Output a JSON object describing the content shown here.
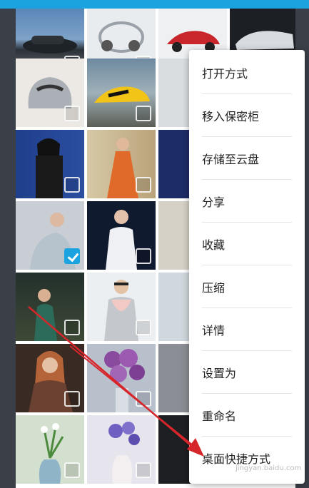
{
  "colors": {
    "accent": "#1aa3de",
    "annotation_arrow": "#d6262b"
  },
  "photo_grid": {
    "thumbnails": [
      {
        "subject": "dark-sedan-car",
        "checked": false
      },
      {
        "subject": "silver-concept-car",
        "checked": false
      },
      {
        "subject": "red-sports-car",
        "checked": false
      },
      {
        "subject": "white-concept-car",
        "checked": false
      },
      {
        "subject": "silver-supercar",
        "checked": false
      },
      {
        "subject": "yellow-race-car",
        "checked": false
      },
      {
        "subject": "car-partial",
        "checked": false
      },
      {
        "subject": "woman-dark-outfit",
        "checked": false
      },
      {
        "subject": "woman-orange-dress",
        "checked": false
      },
      {
        "subject": "woman-partial",
        "checked": false
      },
      {
        "subject": "woman-grey-sweater",
        "checked": true
      },
      {
        "subject": "woman-white-dress",
        "checked": false
      },
      {
        "subject": "woman-partial-2",
        "checked": false
      },
      {
        "subject": "woman-green-dress",
        "checked": false
      },
      {
        "subject": "woman-scarf-sunglasses",
        "checked": false
      },
      {
        "subject": "woman-partial-3",
        "checked": false
      },
      {
        "subject": "woman-brown-coat",
        "checked": false
      },
      {
        "subject": "purple-roses-vase",
        "checked": false
      },
      {
        "subject": "interior-chair",
        "checked": false
      },
      {
        "subject": "white-flowers-vase",
        "checked": false
      },
      {
        "subject": "purple-flowers-vase",
        "checked": false
      },
      {
        "subject": "dark-vase",
        "checked": false
      }
    ]
  },
  "context_menu": {
    "items": [
      {
        "label": "打开方式"
      },
      {
        "label": "移入保密柜"
      },
      {
        "label": "存储至云盘"
      },
      {
        "label": "分享"
      },
      {
        "label": "收藏"
      },
      {
        "label": "压缩"
      },
      {
        "label": "详情"
      },
      {
        "label": "设置为"
      },
      {
        "label": "重命名"
      },
      {
        "label": "桌面快捷方式"
      }
    ]
  },
  "watermark": "jingyan.baidu.com"
}
